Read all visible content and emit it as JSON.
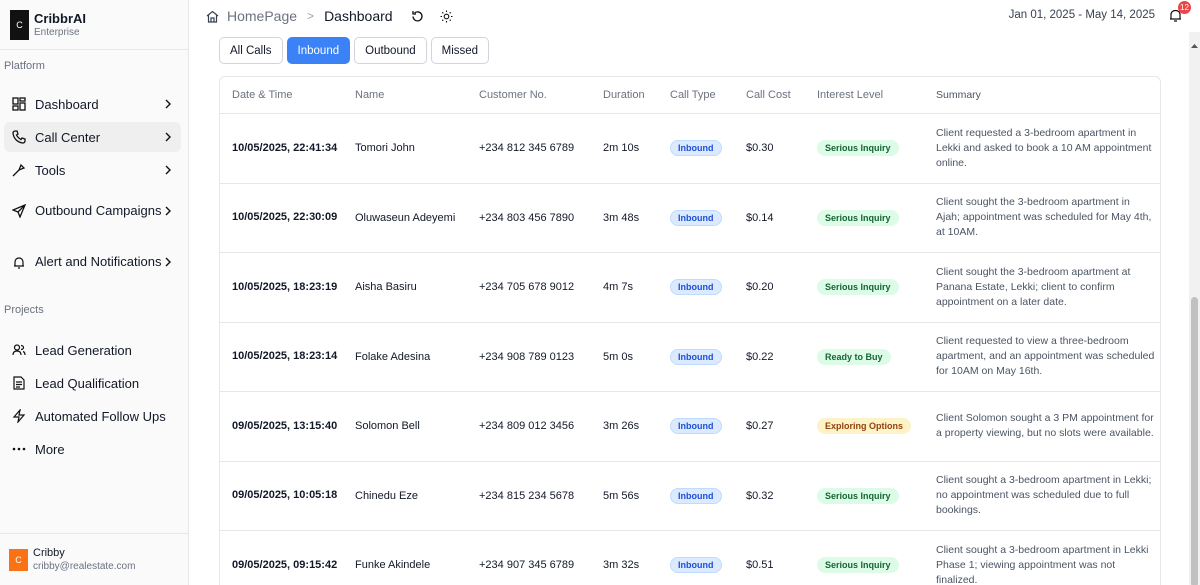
{
  "brand": {
    "logo": "C",
    "name": "CribbrAI",
    "plan": "Enterprise"
  },
  "sidebar": {
    "platform_label": "Platform",
    "platform_items": [
      {
        "label": "Dashboard",
        "icon": "dashboard-icon"
      },
      {
        "label": "Call Center",
        "icon": "phone-icon"
      },
      {
        "label": "Tools",
        "icon": "tools-icon"
      },
      {
        "label": "Outbound Campaigns",
        "icon": "send-icon"
      },
      {
        "label": "Alert and Notifications",
        "icon": "bell-icon"
      }
    ],
    "projects_label": "Projects",
    "project_items": [
      {
        "label": "Lead Generation",
        "icon": "users-icon"
      },
      {
        "label": "Lead Qualification",
        "icon": "document-icon"
      },
      {
        "label": "Automated Follow Ups",
        "icon": "lightning-icon"
      },
      {
        "label": "More",
        "icon": "more-icon"
      }
    ],
    "user": {
      "avatar": "C",
      "name": "Cribby",
      "email": "cribby@realestate.com"
    }
  },
  "header": {
    "breadcrumb_home": "HomePage",
    "breadcrumb_sep": ">",
    "breadcrumb_current": "Dashboard",
    "date_range": "Jan 01, 2025 - May 14, 2025",
    "notification_count": "12"
  },
  "tabs": [
    "All Calls",
    "Inbound",
    "Outbound",
    "Missed"
  ],
  "active_tab": "Inbound",
  "table": {
    "columns": [
      "Date & Time",
      "Name",
      "Customer No.",
      "Duration",
      "Call Type",
      "Call Cost",
      "Interest Level",
      "Summary"
    ],
    "rows": [
      {
        "date": "10/05/2025, 22:41:34",
        "name": "Tomori John",
        "phone": "+234 812 345 6789",
        "duration": "2m 10s",
        "type": "Inbound",
        "cost": "$0.30",
        "interest": "Serious Inquiry",
        "summary": "Client requested a 3-bedroom apartment in Lekki and asked to book a 10 AM appointment online."
      },
      {
        "date": "10/05/2025, 22:30:09",
        "name": "Oluwaseun Adeyemi",
        "phone": "+234 803 456 7890",
        "duration": "3m 48s",
        "type": "Inbound",
        "cost": "$0.14",
        "interest": "Serious Inquiry",
        "summary": "Client sought the 3-bedroom apartment in Ajah; appointment was scheduled for May 4th, at 10AM."
      },
      {
        "date": "10/05/2025, 18:23:19",
        "name": "Aisha Basiru",
        "phone": "+234 705 678 9012",
        "duration": "4m 7s",
        "type": "Inbound",
        "cost": "$0.20",
        "interest": "Serious Inquiry",
        "summary": "Client sought the 3-bedroom apartment at Panana Estate, Lekki; client to confirm appointment on a later date."
      },
      {
        "date": "10/05/2025, 18:23:14",
        "name": "Folake Adesina",
        "phone": "+234 908 789 0123",
        "duration": "5m 0s",
        "type": "Inbound",
        "cost": "$0.22",
        "interest": "Ready to Buy",
        "summary": "Client requested to view a three-bedroom apartment, and an appointment was scheduled for 10AM on May 16th."
      },
      {
        "date": "09/05/2025, 13:15:40",
        "name": "Solomon Bell",
        "phone": "+234 809 012 3456",
        "duration": "3m 26s",
        "type": "Inbound",
        "cost": "$0.27",
        "interest": "Exploring Options",
        "summary": "Client Solomon sought a 3 PM appointment for a property viewing, but no slots were available."
      },
      {
        "date": "09/05/2025, 10:05:18",
        "name": "Chinedu Eze",
        "phone": "+234 815 234 5678",
        "duration": "5m 56s",
        "type": "Inbound",
        "cost": "$0.32",
        "interest": "Serious Inquiry",
        "summary": "Client sought a 3-bedroom apartment in Lekki; no appointment was scheduled due to full bookings."
      },
      {
        "date": "09/05/2025, 09:15:42",
        "name": "Funke Akindele",
        "phone": "+234 907 345 6789",
        "duration": "3m 32s",
        "type": "Inbound",
        "cost": "$0.51",
        "interest": "Serious Inquiry",
        "summary": "Client sought a 3-bedroom apartment in Lekki Phase 1; viewing appointment was not finalized."
      }
    ]
  },
  "colors": {
    "accent": "#3b82f6",
    "badge_blue": "#dbeafe",
    "badge_green": "#dcfce7",
    "badge_yellow": "#fef3c7",
    "notification": "#ef4444"
  }
}
